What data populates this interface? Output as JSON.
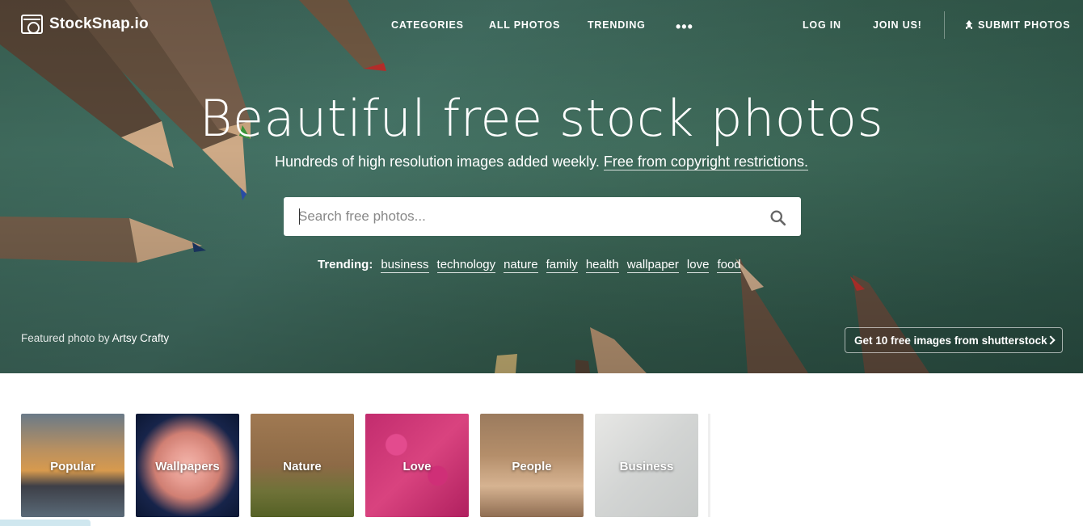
{
  "brand": {
    "name": "StockSnap.io"
  },
  "nav": {
    "categories": "CATEGORIES",
    "all_photos": "ALL PHOTOS",
    "trending": "TRENDING",
    "more": "•••",
    "login": "LOG IN",
    "join": "JOIN US!",
    "submit": "SUBMIT PHOTOS"
  },
  "hero": {
    "title": "Beautiful free stock photos",
    "subtitle": "Hundreds of high resolution images added weekly.",
    "subtitle_link": "Free from copyright restrictions.",
    "search_placeholder": "Search free photos...",
    "trending_label": "Trending:",
    "trending_tags": [
      "business",
      "technology",
      "nature",
      "family",
      "health",
      "wallpaper",
      "love",
      "food"
    ],
    "credit_prefix": "Featured photo by",
    "credit_name": "Artsy Crafty",
    "shutterstock_cta": "Get 10 free images from shutterstock"
  },
  "categories": [
    {
      "label": "Popular"
    },
    {
      "label": "Wallpapers"
    },
    {
      "label": "Nature"
    },
    {
      "label": "Love"
    },
    {
      "label": "People"
    },
    {
      "label": "Business"
    }
  ],
  "icons": {
    "search": "search-icon",
    "upload": "upload-icon",
    "chevron": "chevron-right-icon",
    "logo": "camera-icon"
  },
  "colors": {
    "hero_bg": "#3f6b5c",
    "text": "#ffffff"
  }
}
